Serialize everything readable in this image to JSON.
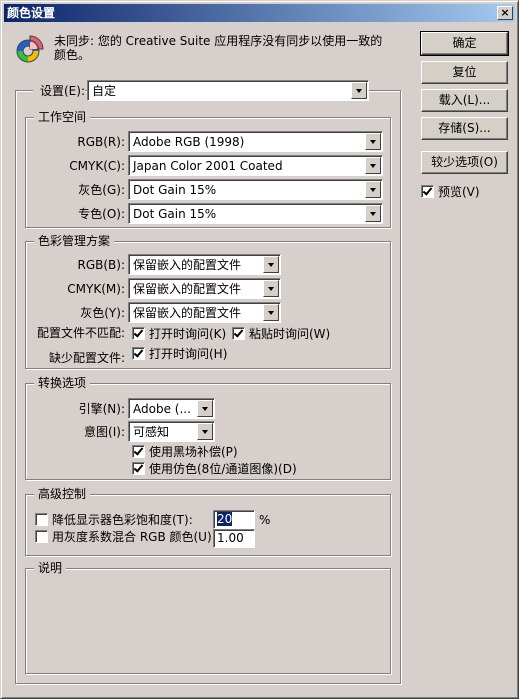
{
  "window": {
    "title": "颜色设置",
    "close_label": "×"
  },
  "message": {
    "icon": "color-sync-icon",
    "text": "未同步: 您的 Creative Suite 应用程序没有同步以使用一致的颜色。"
  },
  "settings": {
    "label": "设置(E):",
    "value": "自定"
  },
  "working_spaces": {
    "title": "工作空间",
    "rows": [
      {
        "label": "RGB(R):",
        "value": "Adobe RGB (1998)"
      },
      {
        "label": "CMYK(C):",
        "value": "Japan Color 2001 Coated"
      },
      {
        "label": "灰色(G):",
        "value": "Dot Gain 15%"
      },
      {
        "label": "专色(O):",
        "value": "Dot Gain 15%"
      }
    ]
  },
  "color_management": {
    "title": "色彩管理方案",
    "rows": [
      {
        "label": "RGB(B):",
        "value": "保留嵌入的配置文件"
      },
      {
        "label": "CMYK(M):",
        "value": "保留嵌入的配置文件"
      },
      {
        "label": "灰色(Y):",
        "value": "保留嵌入的配置文件"
      }
    ],
    "mismatch_label": "配置文件不匹配:",
    "mismatch_open": {
      "label": "打开时询问(K)",
      "checked": true
    },
    "mismatch_paste": {
      "label": "粘贴时询问(W)",
      "checked": true
    },
    "missing_label": "缺少配置文件:",
    "missing_open": {
      "label": "打开时询问(H)",
      "checked": true
    }
  },
  "conversion": {
    "title": "转换选项",
    "engine_label": "引擎(N):",
    "engine_value": "Adobe (...",
    "intent_label": "意图(I):",
    "intent_value": "可感知",
    "black_point": {
      "label": "使用黑场补偿(P)",
      "checked": true
    },
    "dither": {
      "label": "使用仿色(8位/通道图像)(D)",
      "checked": true
    }
  },
  "advanced": {
    "title": "高级控制",
    "desaturate": {
      "label": "降低显示器色彩饱和度(T):",
      "checked": false,
      "value": "20",
      "unit": "%"
    },
    "blend_gamma": {
      "label": "用灰度系数混合 RGB 颜色(U):",
      "checked": false,
      "value": "1.00"
    }
  },
  "description": {
    "title": "说明"
  },
  "buttons": {
    "ok": "确定",
    "reset": "复位",
    "load": "载入(L)...",
    "save": "存储(S)...",
    "fewer_options": "较少选项(O)"
  },
  "preview": {
    "label": "预览(V)",
    "checked": true
  }
}
